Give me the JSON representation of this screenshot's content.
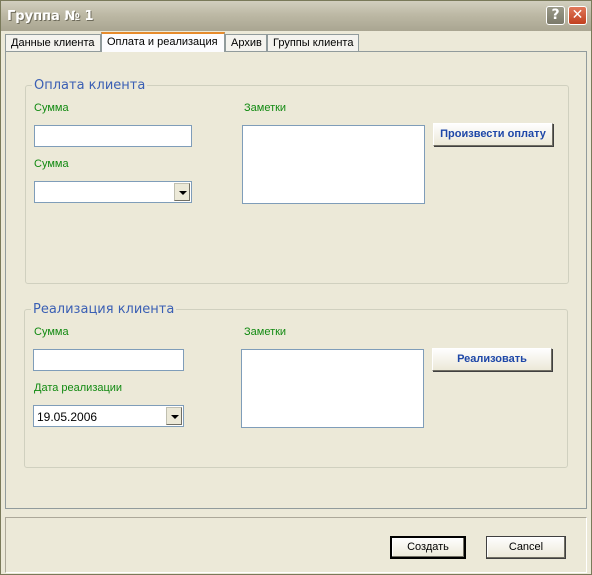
{
  "window": {
    "title": "Группа № 1",
    "help_label": "?",
    "close_label": "✕"
  },
  "tabs": [
    {
      "label": "Данные клиента",
      "active": false
    },
    {
      "label": "Оплата и реализация",
      "active": true
    },
    {
      "label": "Архив",
      "active": false
    },
    {
      "label": "Группы клиента",
      "active": false
    }
  ],
  "payment": {
    "title": "Оплата клиента",
    "amount_label": "Сумма",
    "amount_value": "",
    "amount2_label": "Сумма",
    "amount2_value": "",
    "notes_label": "Заметки",
    "notes_value": "",
    "action_label": "Произвести оплату"
  },
  "realization": {
    "title": "Реализация клиента",
    "amount_label": "Сумма",
    "amount_value": "",
    "date_label": "Дата реализации",
    "date_value": "19.05.2006",
    "notes_label": "Заметки",
    "notes_value": "",
    "action_label": "Реализовать"
  },
  "footer": {
    "create_label": "Создать",
    "cancel_label": "Cancel"
  },
  "colors": {
    "label_green": "#118a11",
    "group_title_blue": "#3a5fb4",
    "window_bg": "#ece9d8",
    "active_tab_accent": "#e68b2c"
  }
}
